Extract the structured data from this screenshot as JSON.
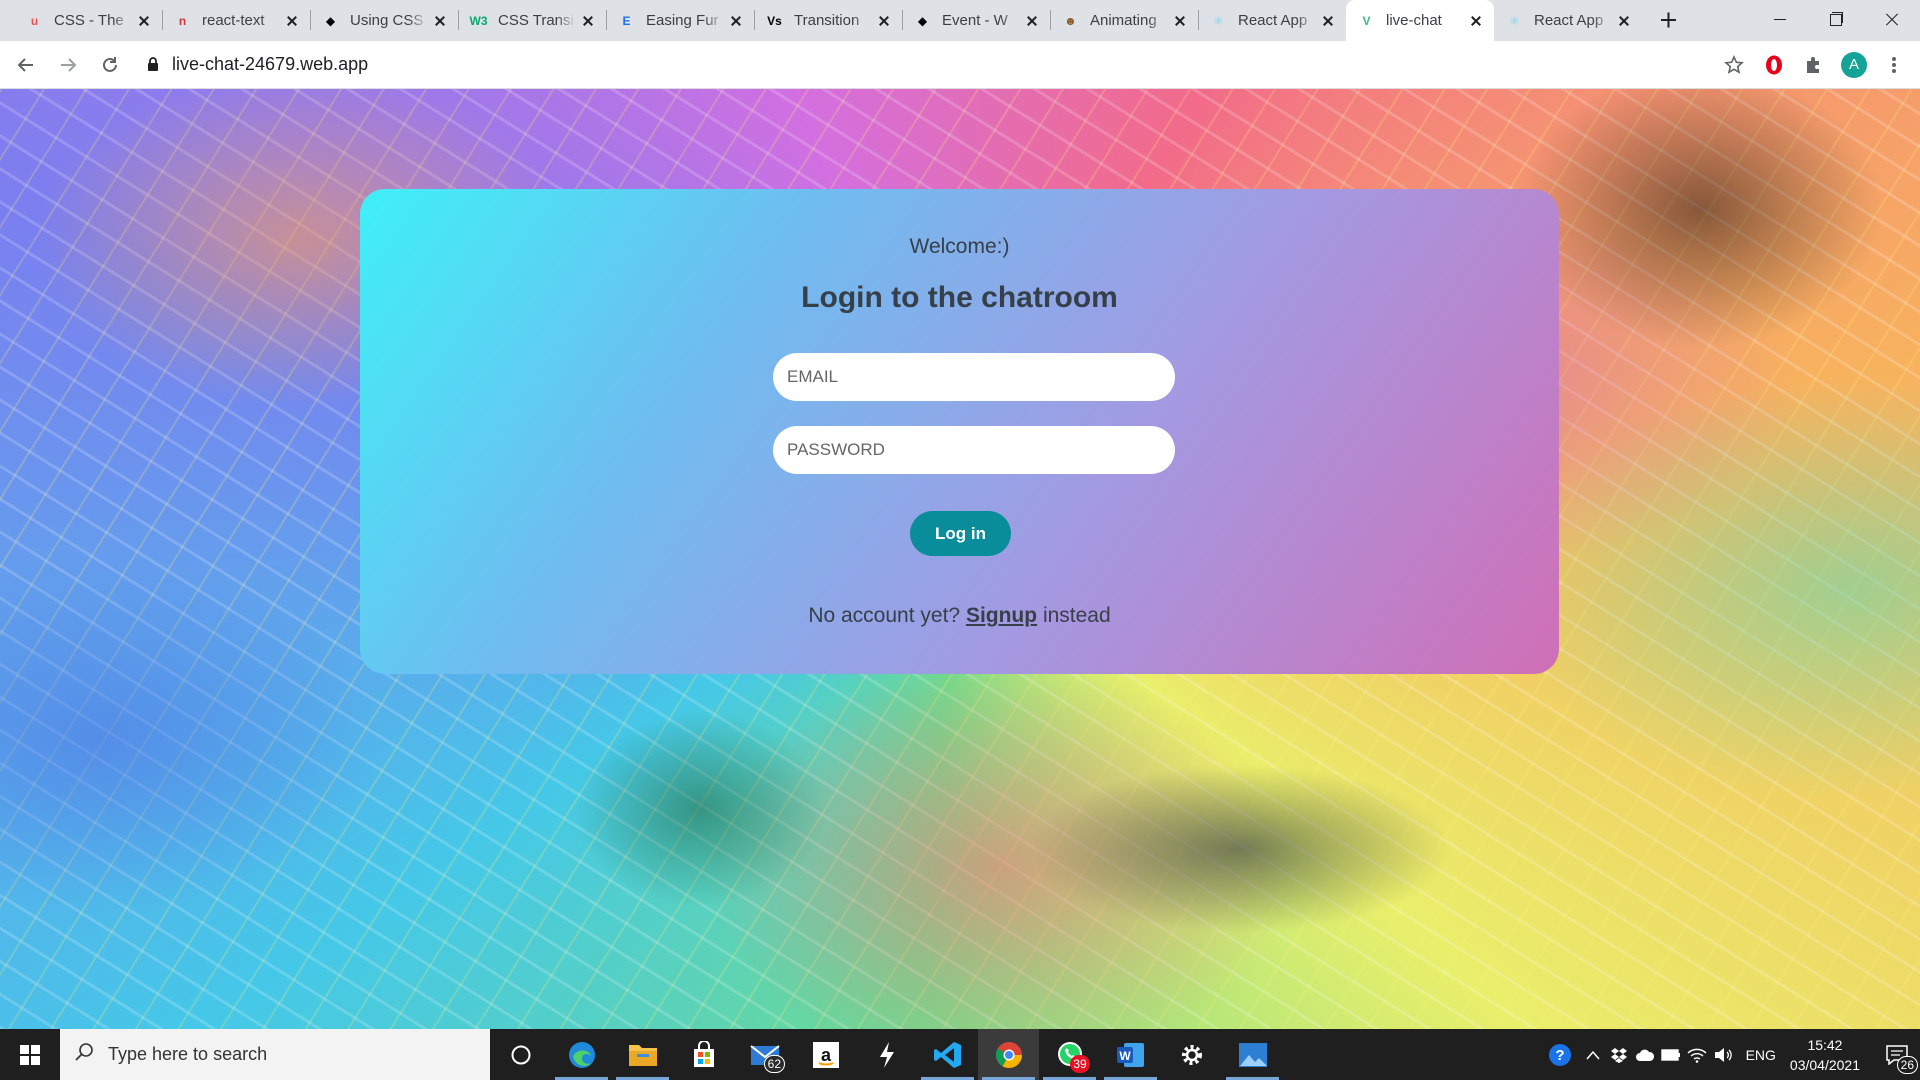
{
  "browser": {
    "tabs": [
      {
        "title": "CSS - The",
        "favicon": "udemy-icon",
        "color": "#ec5252",
        "glyph": "u"
      },
      {
        "title": "react-text",
        "favicon": "npm-icon",
        "color": "#cb3837",
        "glyph": "n"
      },
      {
        "title": "Using CSS",
        "favicon": "mdn-icon",
        "color": "#000000",
        "glyph": "◆"
      },
      {
        "title": "CSS Transi",
        "favicon": "w3schools-icon",
        "color": "#04aa6d",
        "glyph": "W3"
      },
      {
        "title": "Easing Fur",
        "favicon": "easings-icon",
        "color": "#1a73e8",
        "glyph": "E"
      },
      {
        "title": "Transition",
        "favicon": "vs-icon",
        "color": "#000000",
        "glyph": "Vs"
      },
      {
        "title": "Event - W",
        "favicon": "mdn-icon",
        "color": "#000000",
        "glyph": "◆"
      },
      {
        "title": "Animating",
        "favicon": "monkey-icon",
        "color": "#8a5a2b",
        "glyph": "☻"
      },
      {
        "title": "React App",
        "favicon": "react-icon",
        "color": "#61dafb",
        "glyph": "⚛"
      },
      {
        "title": "live-chat",
        "favicon": "vue-icon",
        "color": "#42b883",
        "glyph": "V"
      },
      {
        "title": "React App",
        "favicon": "react-icon",
        "color": "#61dafb",
        "glyph": "⚛"
      }
    ],
    "active_tab_index": 9,
    "url": "live-chat-24679.web.app",
    "profile_initial": "A"
  },
  "login": {
    "welcome": "Welcome:)",
    "title": "Login to the chatroom",
    "email_placeholder": "EMAIL",
    "password_placeholder": "PASSWORD",
    "button_label": "Log in",
    "signup_prefix": "No account yet?",
    "signup_link": "Signup",
    "signup_suffix": "instead"
  },
  "taskbar": {
    "search_placeholder": "Type here to search",
    "mail_badge": "62",
    "whatsapp_badge": "39",
    "language": "ENG",
    "time": "15:42",
    "date": "03/04/2021",
    "notification_count": "26"
  }
}
